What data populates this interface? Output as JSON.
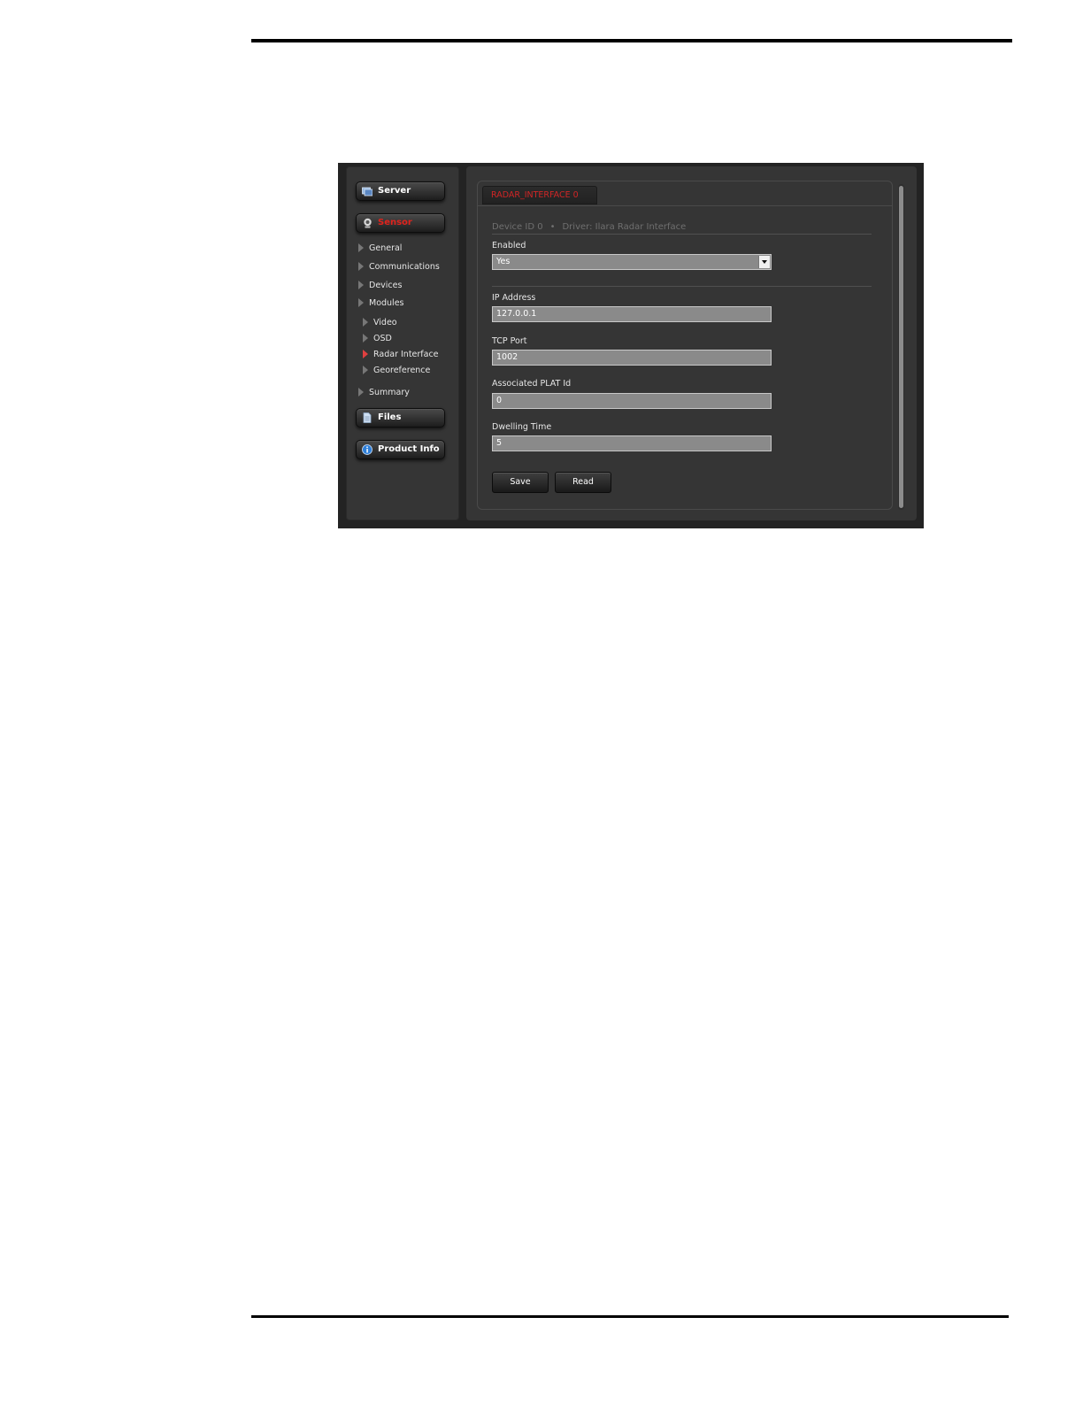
{
  "sidebar": {
    "buttons": {
      "server": "Server",
      "sensor": "Sensor",
      "files": "Files",
      "product_info": "Product Info"
    },
    "tree": {
      "general": "General",
      "communications": "Communications",
      "devices": "Devices",
      "modules": "Modules",
      "video": "Video",
      "osd": "OSD",
      "radar_interface": "Radar Interface",
      "georeference": "Georeference",
      "summary": "Summary"
    }
  },
  "main": {
    "tab_label": "RADAR_INTERFACE 0",
    "device_id": "Device ID 0",
    "separator": "•",
    "driver": "Driver: Ilara Radar Interface",
    "fields": {
      "enabled_label": "Enabled",
      "enabled_value": "Yes",
      "ip_label": "IP Address",
      "ip_value": "127.0.0.1",
      "tcp_label": "TCP Port",
      "tcp_value": "1002",
      "plat_label": "Associated PLAT Id",
      "plat_value": "0",
      "dwell_label": "Dwelling Time",
      "dwell_value": "5"
    },
    "save_label": "Save",
    "read_label": "Read"
  },
  "colors": {
    "accent_red": "#e0231d",
    "panel_bg": "#353535",
    "frame_bg": "#232323"
  }
}
